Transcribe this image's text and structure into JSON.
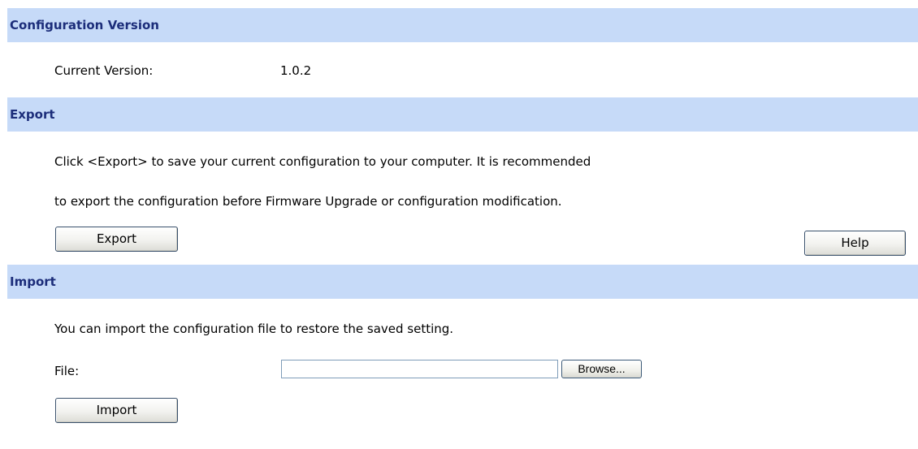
{
  "config_version": {
    "header": "Configuration Version",
    "current_version_label": "Current Version:",
    "current_version_value": "1.0.2"
  },
  "export": {
    "header": "Export",
    "description_line1": "Click <Export> to save your current configuration to your computer. It is recommended",
    "description_line2": "to export the configuration before Firmware Upgrade or configuration modification.",
    "export_button": "Export",
    "help_button": "Help"
  },
  "import": {
    "header": "Import",
    "description": "You can import the configuration file to restore the saved setting.",
    "file_label": "File:",
    "file_value": "",
    "browse_button": "Browse...",
    "import_button": "Import"
  },
  "colors": {
    "header_background": "#c6daf8",
    "header_text": "#1c2d7a"
  }
}
